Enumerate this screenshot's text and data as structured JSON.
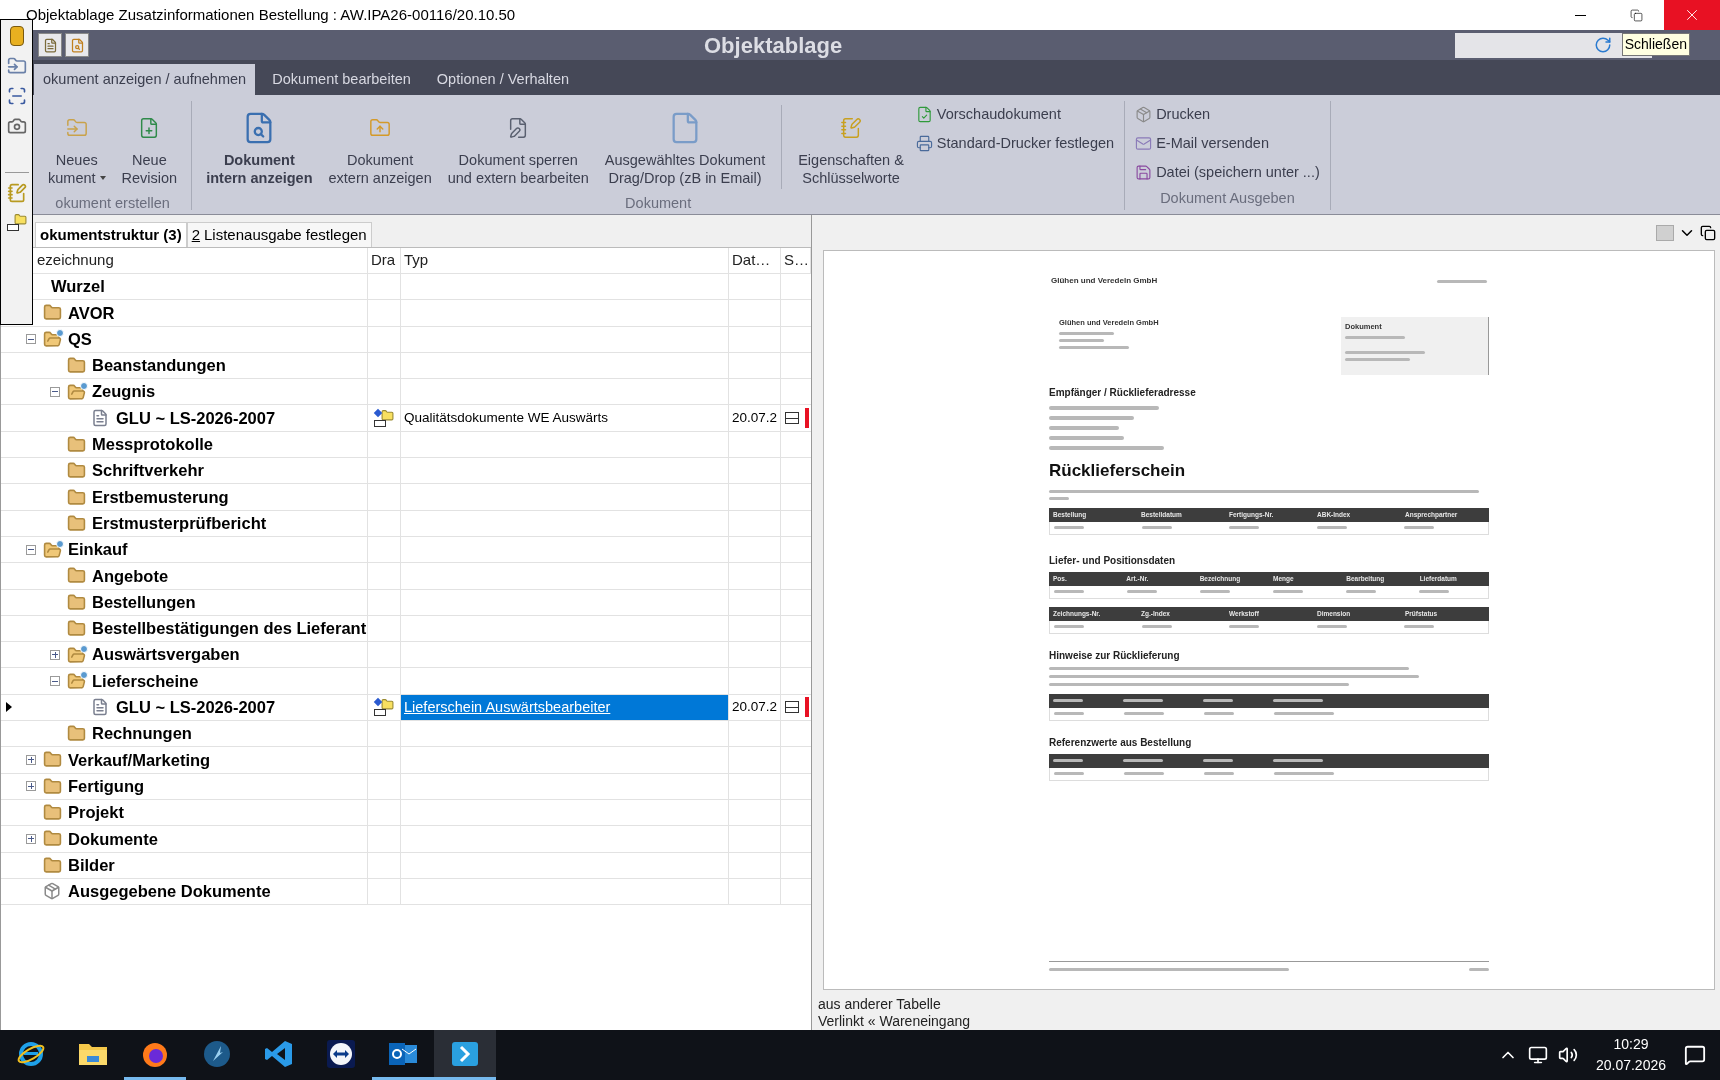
{
  "window": {
    "title": "Objektablage Zusatzinformationen Bestellung : AW.IPA26-00116/20.10.50",
    "tooltip": "Schließen"
  },
  "header": {
    "title": "Objektablage"
  },
  "ribbon_tabs": [
    {
      "label": "okument anzeigen / aufnehmen",
      "selected": true
    },
    {
      "label": "Dokument bearbeiten",
      "selected": false
    },
    {
      "label": "Optionen / Verhalten",
      "selected": false
    }
  ],
  "ribbon_groups": [
    {
      "label": "okument erstellen",
      "items": [
        {
          "kind": "large",
          "lines": [
            "Neues",
            "kument"
          ],
          "dropdown": true,
          "default": false
        },
        {
          "kind": "large",
          "lines": [
            "Neue",
            "Revision"
          ],
          "dropdown": false,
          "default": false
        }
      ]
    },
    {
      "label": "Dokument",
      "items": [
        {
          "kind": "large",
          "lines": [
            "Dokument",
            "intern anzeigen"
          ],
          "dropdown": false,
          "default": true
        },
        {
          "kind": "large",
          "lines": [
            "Dokument",
            "extern anzeigen"
          ],
          "dropdown": false,
          "default": false
        },
        {
          "kind": "large",
          "lines": [
            "Dokument sperren",
            "und extern bearbeiten"
          ],
          "dropdown": false,
          "default": false
        },
        {
          "kind": "large",
          "lines": [
            "Ausgewähltes Dokument",
            "Drag/Drop (zB in Email)"
          ],
          "dropdown": false,
          "default": false
        },
        {
          "kind": "separator"
        },
        {
          "kind": "large",
          "lines": [
            "Eigenschaften &",
            "Schlüsselworte"
          ],
          "dropdown": false,
          "default": false
        },
        {
          "kind": "small",
          "items": [
            {
              "label": "Vorschaudokument"
            },
            {
              "label": "Standard-Drucker festlegen"
            }
          ]
        }
      ]
    },
    {
      "label": "Dokument Ausgeben",
      "items": [
        {
          "kind": "small",
          "items": [
            {
              "label": "Drucken"
            },
            {
              "label": "E-Mail versenden"
            },
            {
              "label": "Datei (speichern unter ...)"
            }
          ]
        }
      ]
    }
  ],
  "panel_tabs": [
    {
      "label": "okumentstruktur (3)",
      "selected": true
    },
    {
      "mnemonic": "2",
      "label": "Listenausgabe festlegen",
      "selected": false
    }
  ],
  "columns": [
    "ezeichnung",
    "Dra",
    "Typ",
    "Dat…",
    "S…"
  ],
  "tree": {
    "name": "Wurzel",
    "selected": false,
    "children": [
      {
        "name": "AVOR",
        "kind": "folder",
        "selected": false
      },
      {
        "name": "QS",
        "kind": "shared-folder",
        "expanded": true,
        "selected": false,
        "children": [
          {
            "name": "Beanstandungen",
            "kind": "folder",
            "selected": false
          },
          {
            "name": "Zeugnis",
            "kind": "shared-folder",
            "expanded": true,
            "selected": false,
            "children": [
              {
                "name": "GLU ~ LS-2026-2007",
                "kind": "document",
                "selected": false,
                "type": "Qualitätsdokumente WE Auswärts",
                "date": "20.07.2"
              }
            ]
          },
          {
            "name": "Messprotokolle",
            "kind": "folder",
            "selected": false
          },
          {
            "name": "Schriftverkehr",
            "kind": "folder",
            "selected": false
          },
          {
            "name": "Erstbemusterung",
            "kind": "folder",
            "selected": false
          },
          {
            "name": "Erstmusterprüfbericht",
            "kind": "folder",
            "selected": false
          }
        ]
      },
      {
        "name": "Einkauf",
        "kind": "shared-folder",
        "expanded": true,
        "selected": false,
        "children": [
          {
            "name": "Angebote",
            "kind": "folder",
            "selected": false
          },
          {
            "name": "Bestellungen",
            "kind": "folder",
            "selected": false
          },
          {
            "name": "Bestellbestätigungen des Lieferant",
            "kind": "folder",
            "selected": false
          },
          {
            "name": "Auswärtsvergaben",
            "kind": "shared-folder",
            "expanded": false,
            "selected": false
          },
          {
            "name": "Lieferscheine",
            "kind": "shared-folder",
            "expanded": true,
            "selected": false,
            "children": [
              {
                "name": "GLU ~ LS-2026-2007",
                "kind": "document",
                "selected": true,
                "type": "Lieferschein Auswärtsbearbeiter",
                "date": "20.07.2"
              }
            ]
          },
          {
            "name": "Rechnungen",
            "kind": "folder",
            "selected": false
          }
        ]
      },
      {
        "name": "Verkauf/Marketing",
        "kind": "folder",
        "expanded": false,
        "selected": false
      },
      {
        "name": "Fertigung",
        "kind": "folder",
        "expanded": false,
        "selected": false
      },
      {
        "name": "Projekt",
        "kind": "folder",
        "selected": false
      },
      {
        "name": "Dokumente",
        "kind": "folder",
        "expanded": false,
        "selected": false
      },
      {
        "name": "Bilder",
        "kind": "folder",
        "selected": false
      },
      {
        "name": "Ausgegebene Dokumente",
        "kind": "box",
        "selected": false
      }
    ]
  },
  "preview": {
    "company": "Glühen und Veredeln GmbH",
    "sender": "Glühen und Veredeln GmbH",
    "info_label": "Dokument",
    "recipient_heading": "Empfänger / Rücklieferadresse",
    "title": "Rücklieferschein",
    "tables": [
      {
        "kind": "table",
        "columns": [
          "Bestellung",
          "Bestelldatum",
          "Fertigungs-Nr.",
          "ABK-Index",
          "Ansprechpartner"
        ]
      },
      {
        "kind": "table",
        "heading": "Liefer- und Positionsdaten",
        "columns": [
          "Pos.",
          "Art.-Nr.",
          "Bezeichnung",
          "Menge",
          "Bearbeitung",
          "Lieferdatum"
        ]
      },
      {
        "kind": "table",
        "columns": [
          "Zeichnungs-Nr.",
          "Zg.-Index",
          "Werkstoff",
          "Dimension",
          "Prüfstatus"
        ]
      },
      {
        "kind": "note-table",
        "heading": "Hinweise zur Rücklieferung"
      },
      {
        "kind": "blurred-table",
        "heading": "Referenzwerte aus Bestellung"
      }
    ]
  },
  "status_lines": [
    "aus anderer Tabelle",
    "Verlinkt « Wareneingang"
  ],
  "taskbar": {
    "apps": [
      {
        "running": false,
        "selected": false
      },
      {
        "running": false,
        "selected": false
      },
      {
        "running": true,
        "selected": false
      },
      {
        "running": false,
        "selected": false
      },
      {
        "running": false,
        "selected": false
      },
      {
        "running": false,
        "selected": false
      },
      {
        "running": true,
        "selected": false
      },
      {
        "running": true,
        "selected": true
      }
    ],
    "time": "10:29",
    "date": "20.07.2026"
  }
}
